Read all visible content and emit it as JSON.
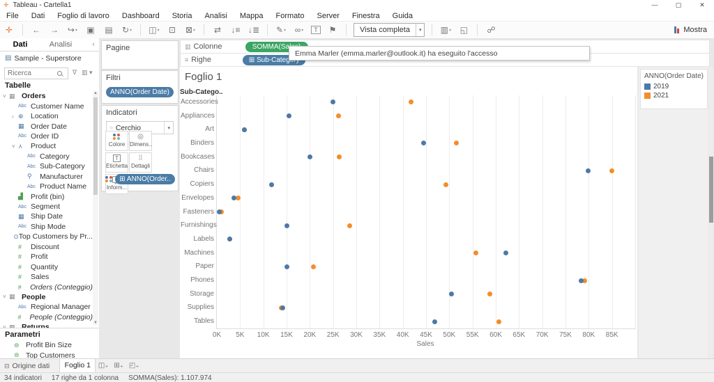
{
  "window": {
    "title": "Tableau - Cartella1"
  },
  "menu": {
    "items": [
      "File",
      "Dati",
      "Foglio di lavoro",
      "Dashboard",
      "Storia",
      "Analisi",
      "Mappa",
      "Formato",
      "Server",
      "Finestra",
      "Guida"
    ]
  },
  "toolbar": {
    "fit_dropdown": "Vista completa",
    "show_me_label": "Mostra",
    "items": [
      {
        "name": "tableau-logo-icon",
        "glyph": "✛",
        "color": "#e8762d"
      },
      {
        "sep": true
      },
      {
        "name": "undo-icon",
        "glyph": "←"
      },
      {
        "name": "redo-icon",
        "glyph": "→"
      },
      {
        "name": "replay-icon",
        "glyph": "↪",
        "caret": true
      },
      {
        "name": "save-icon",
        "glyph": "▣"
      },
      {
        "name": "new-datasource-icon",
        "glyph": "▤"
      },
      {
        "name": "refresh-icon",
        "glyph": "↻",
        "caret": true
      },
      {
        "sep": true
      },
      {
        "name": "new-worksheet-icon",
        "glyph": "◫",
        "caret": true
      },
      {
        "name": "duplicate-icon",
        "glyph": "⊡"
      },
      {
        "name": "clear-sheet-icon",
        "glyph": "⊠",
        "caret": true
      },
      {
        "sep": true
      },
      {
        "name": "swap-axes-icon",
        "glyph": "⇄"
      },
      {
        "name": "sort-ascending-icon",
        "glyph": "↓≡"
      },
      {
        "name": "sort-descending-icon",
        "glyph": "↓≣"
      },
      {
        "sep": true
      },
      {
        "name": "highlight-icon",
        "glyph": "✎",
        "caret": true
      },
      {
        "name": "group-members-icon",
        "glyph": "∞",
        "caret": true
      },
      {
        "name": "show-mark-labels-icon",
        "glyph": "T",
        "boxed": true
      },
      {
        "name": "fix-axes-icon",
        "glyph": "⚑"
      },
      {
        "sep": true
      },
      {
        "fit": true
      },
      {
        "sep": true
      },
      {
        "name": "show-hide-cards-icon",
        "glyph": "▥",
        "caret": true
      },
      {
        "name": "presentation-mode-icon",
        "glyph": "◱"
      },
      {
        "sep": true
      },
      {
        "name": "share-icon",
        "glyph": "☍"
      },
      {
        "spacer": true
      },
      {
        "showme": true
      }
    ]
  },
  "toast": {
    "text": "Emma Marler (emma.marler@outlook.it) ha eseguito l'accesso"
  },
  "data_pane": {
    "tabs": [
      "Dati",
      "Analisi"
    ],
    "datasource": "Sample - Superstore",
    "search_placeholder": "Ricerca",
    "tables_header": "Tabelle",
    "fields": [
      {
        "label": "Orders",
        "icon": "table",
        "bold": true,
        "level": 0,
        "caret": "v"
      },
      {
        "label": "Customer Name",
        "icon": "abc",
        "level": 1
      },
      {
        "label": "Location",
        "icon": "geo",
        "level": 1,
        "caret": ">"
      },
      {
        "label": "Order Date",
        "icon": "calendar",
        "level": 1
      },
      {
        "label": "Order ID",
        "icon": "abc",
        "level": 1
      },
      {
        "label": "Product",
        "icon": "hierarchy",
        "level": 1,
        "caret": "v"
      },
      {
        "label": "Category",
        "icon": "abc",
        "level": 2
      },
      {
        "label": "Sub-Category",
        "icon": "abc",
        "level": 2
      },
      {
        "label": "Manufacturer",
        "icon": "clip",
        "level": 2
      },
      {
        "label": "Product Name",
        "icon": "abc",
        "level": 2
      },
      {
        "label": "Profit (bin)",
        "icon": "bin",
        "level": 1
      },
      {
        "label": "Segment",
        "icon": "abc",
        "level": 1
      },
      {
        "label": "Ship Date",
        "icon": "calendar",
        "level": 1
      },
      {
        "label": "Ship Mode",
        "icon": "abc",
        "level": 1
      },
      {
        "label": "Top Customers by Pr...",
        "icon": "set",
        "level": 1
      },
      {
        "label": "Discount",
        "icon": "num",
        "level": 1
      },
      {
        "label": "Profit",
        "icon": "num",
        "level": 1
      },
      {
        "label": "Quantity",
        "icon": "num",
        "level": 1
      },
      {
        "label": "Sales",
        "icon": "num",
        "level": 1
      },
      {
        "label": "Orders (Conteggio)",
        "icon": "num",
        "level": 1,
        "italic": true
      },
      {
        "label": "People",
        "icon": "table",
        "bold": true,
        "level": 0,
        "caret": "v"
      },
      {
        "label": "Regional Manager",
        "icon": "abc",
        "level": 1
      },
      {
        "label": "People (Conteggio)",
        "icon": "num",
        "level": 1,
        "italic": true
      },
      {
        "label": "Returns",
        "icon": "table",
        "bold": true,
        "level": 0,
        "caret": "v"
      }
    ],
    "parameters": {
      "header": "Parametri",
      "items": [
        "Profit Bin Size",
        "Top Customers"
      ]
    }
  },
  "cards": {
    "pagine": {
      "title": "Pagine"
    },
    "filtri": {
      "title": "Filtri",
      "pill": "ANNO(Order Date)"
    },
    "indicatori": {
      "title": "Indicatori",
      "mark_type": "Cerchio",
      "buttons": [
        {
          "label": "Colore",
          "icon": "color"
        },
        {
          "label": "Dimens...",
          "icon": "size"
        },
        {
          "label": "Etichetta",
          "icon": "label"
        },
        {
          "label": "Dettagli",
          "icon": "detail"
        },
        {
          "label": "Inform...",
          "icon": "tooltip"
        }
      ],
      "pill": "ANNO(Order.."
    }
  },
  "shelves": {
    "colonne": {
      "label": "Colonne",
      "pill": "SOMMA(Sales)"
    },
    "righe": {
      "label": "Righe",
      "pill": "Sub-Category"
    }
  },
  "sheet": {
    "title": "Foglio 1",
    "row_header": "Sub-Catego.."
  },
  "legend": {
    "title": "ANNO(Order Date)",
    "items": [
      {
        "label": "2019",
        "color": "#4e79a7"
      },
      {
        "label": "2021",
        "color": "#f28e2b"
      }
    ]
  },
  "tabs_bar": {
    "datasource_tab": "Origine dati",
    "sheet_tab": "Foglio 1"
  },
  "status_bar": {
    "marks": "34 indicatori",
    "rows": "17 righe da 1 colonna",
    "aggregate": "SOMMA(Sales): 1.107.974"
  },
  "chart_data": {
    "type": "scatter",
    "title": "Foglio 1",
    "xlabel": "Sales",
    "ylabel": "Sub-Category",
    "xlim": [
      0,
      90000
    ],
    "x_ticks": [
      "0K",
      "5K",
      "10K",
      "15K",
      "20K",
      "25K",
      "30K",
      "35K",
      "40K",
      "45K",
      "50K",
      "55K",
      "60K",
      "65K",
      "70K",
      "75K",
      "80K",
      "85K"
    ],
    "grid": "vertical",
    "legend_title": "ANNO(Order Date)",
    "legend_position": "top-right",
    "categories": [
      "Accessories",
      "Appliances",
      "Art",
      "Binders",
      "Bookcases",
      "Chairs",
      "Copiers",
      "Envelopes",
      "Fasteners",
      "Furnishings",
      "Labels",
      "Machines",
      "Paper",
      "Phones",
      "Storage",
      "Supplies",
      "Tables"
    ],
    "series": [
      {
        "name": "2019",
        "color": "#4e79a7",
        "values": [
          24900,
          15500,
          5900,
          44400,
          20000,
          79900,
          11800,
          3600,
          500,
          15000,
          2700,
          62200,
          15100,
          78300,
          50400,
          14200,
          46900
        ]
      },
      {
        "name": "2021",
        "color": "#f28e2b",
        "values": [
          41700,
          26100,
          5900,
          51500,
          26300,
          85000,
          49200,
          4500,
          1000,
          28500,
          2700,
          55700,
          20700,
          79100,
          58700,
          13800,
          60700
        ]
      }
    ]
  }
}
